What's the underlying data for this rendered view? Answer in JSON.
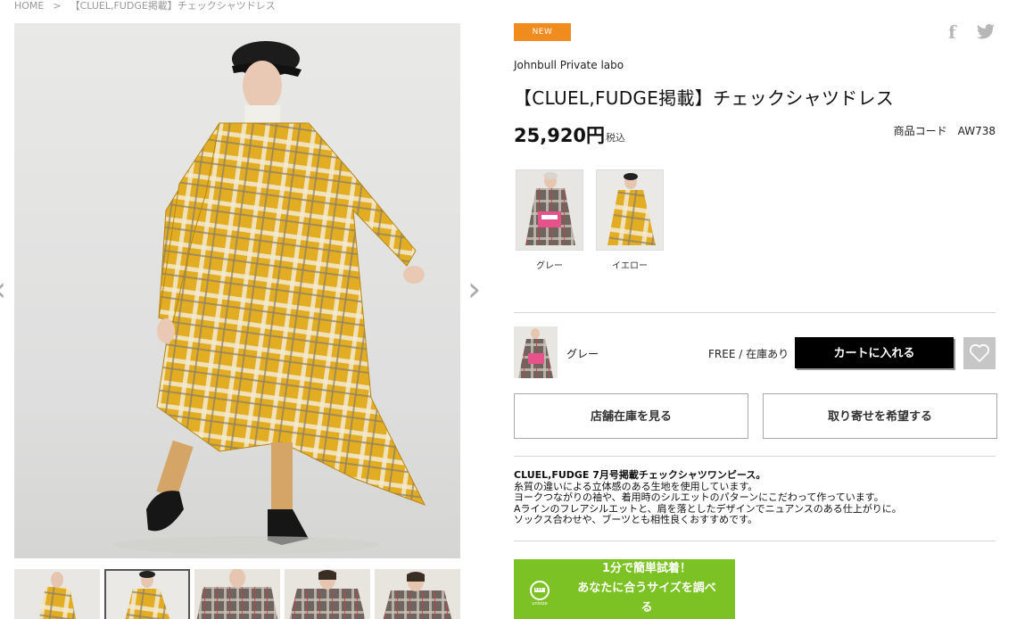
{
  "breadcrumb": {
    "home": "HOME",
    "separator": ">",
    "current": "【CLUEL,FUDGE掲載】チェックシャツドレス"
  },
  "product": {
    "badge": "NEW",
    "brand": "Johnbull Private labo",
    "title": "【CLUEL,FUDGE掲載】チェックシャツドレス",
    "price": "25,920円",
    "tax_label": "税込",
    "code_label": "商品コード",
    "code_value": "AW738"
  },
  "share": {
    "facebook_icon": "f",
    "twitter_icon": "twitter-bird"
  },
  "colors": [
    {
      "label": "グレー"
    },
    {
      "label": "イエロー"
    }
  ],
  "cart": {
    "color": "グレー",
    "size_stock": "FREE /  在庫あり",
    "add_button": "カートに入れる",
    "favorite_icon": "heart-outline"
  },
  "actions": {
    "store_stock": "店舗在庫を見る",
    "request_transfer": "取り寄せを希望する"
  },
  "description": {
    "title": "CLUEL,FUDGE 7月号掲載チェックシャツワンピース。",
    "lines": [
      "糸質の違いによる立体感のある生地を使用しています。",
      "ヨークつながりの袖や、着用時のシルエットのパターンにこだわって作っています。",
      "Aラインのフレアシルエットと、肩を落としたデザインでニュアンスのある仕上がりに。",
      "ソックス合わせや、ブーツとも相性良くおすすめです。"
    ]
  },
  "promo": {
    "line1": "1分で簡単試着！",
    "line2": "あなたに合うサイズを調べ",
    "line3": "る",
    "logo_text": "unisize"
  },
  "colors_palette": {
    "accent_orange": "#f08c1e",
    "promo_green": "#7cc224",
    "plaid_yellow": "#e8b92a"
  }
}
